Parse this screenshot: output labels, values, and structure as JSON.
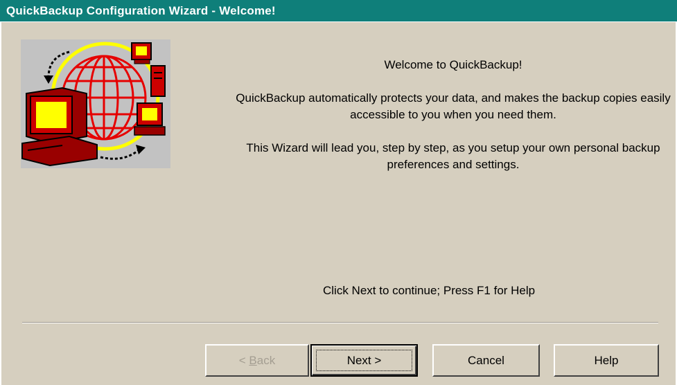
{
  "window": {
    "title": "QuickBackup Configuration Wizard - Welcome!"
  },
  "content": {
    "welcome": "Welcome to QuickBackup!",
    "paragraph1": "QuickBackup automatically protects your data, and makes the backup copies easily accessible to you when you need them.",
    "paragraph2": "This Wizard will lead you, step by step, as you setup your own personal backup preferences and settings.",
    "hint": "Click Next to continue; Press F1 for Help"
  },
  "buttons": {
    "back_prefix": "< ",
    "back_mnemonic": "B",
    "back_rest": "ack",
    "next": "Next >",
    "cancel": "Cancel",
    "help": "Help"
  },
  "colors": {
    "titlebar": "#0f7f7a",
    "face": "#d6cfbf",
    "illustration_bg": "#c2c2c2",
    "globe": "#e60000",
    "ring": "#ffff00",
    "screen": "#ffff00",
    "disabled_text": "#a49e92"
  },
  "icons": {
    "illustration": "network-backup-illustration"
  }
}
